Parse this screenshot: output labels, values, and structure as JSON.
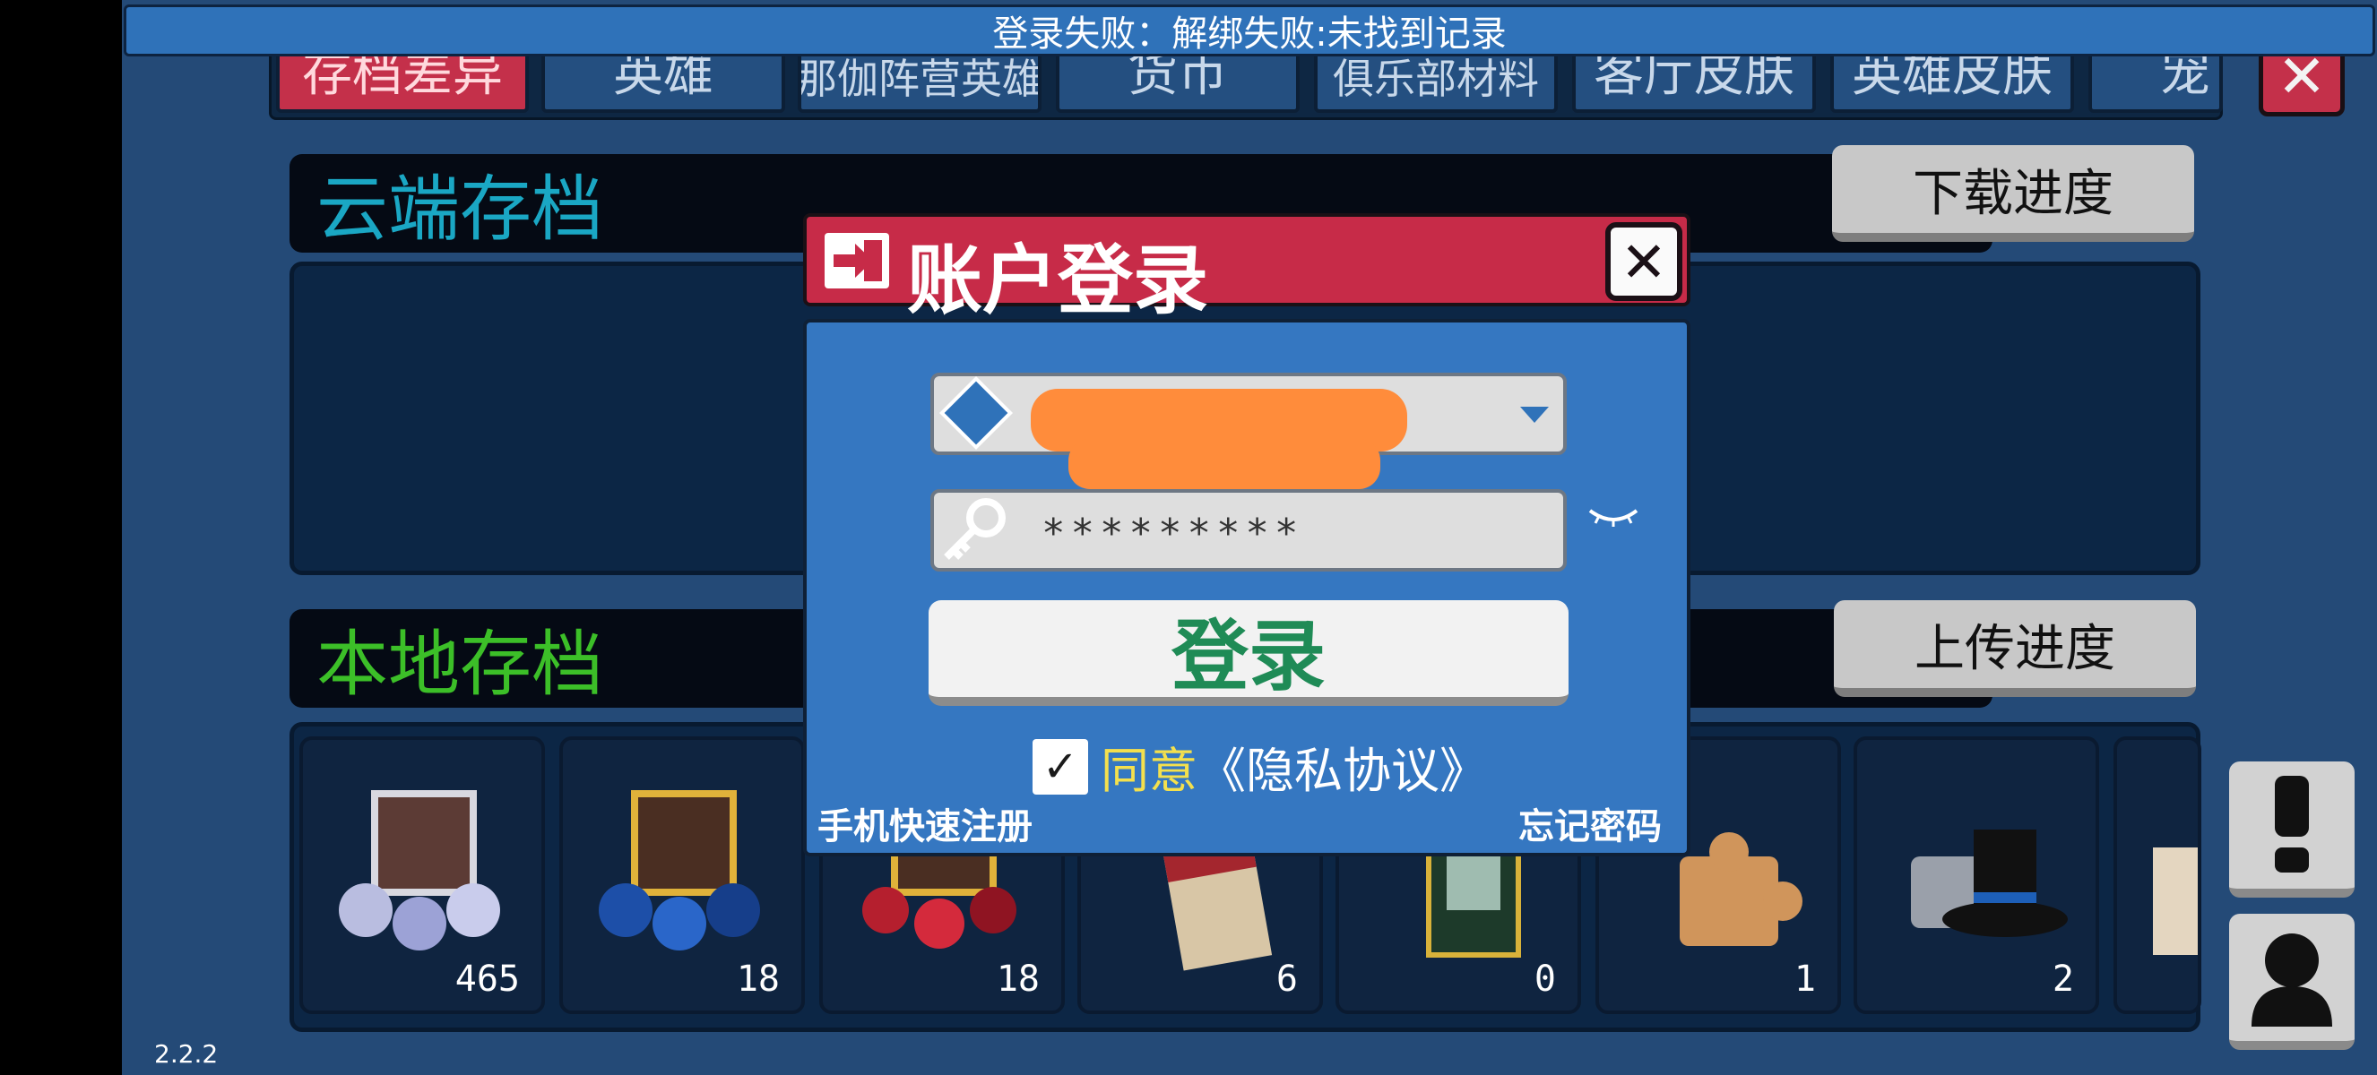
{
  "toast": {
    "message": "登录失败：解绑失败:未找到记录"
  },
  "tabs": [
    {
      "label": "存档差异",
      "active": true
    },
    {
      "label": "英雄",
      "active": false
    },
    {
      "label": "那伽阵营英雄",
      "active": false
    },
    {
      "label": "货币",
      "active": false
    },
    {
      "label": "俱乐部材料",
      "active": false
    },
    {
      "label": "客厅皮肤",
      "active": false
    },
    {
      "label": "英雄皮肤",
      "active": false
    },
    {
      "label": "宠",
      "active": false
    }
  ],
  "cloud": {
    "title": "云端存档",
    "button": "下载进度"
  },
  "local": {
    "title": "本地存档",
    "button": "上传进度",
    "items": [
      {
        "icon": "silver-gem-chest-icon",
        "count": "465"
      },
      {
        "icon": "gold-gem-chest-icon",
        "count": "18"
      },
      {
        "icon": "red-gem-chest-icon",
        "count": "18"
      },
      {
        "icon": "ticket-icon",
        "count": "6"
      },
      {
        "icon": "card-icon",
        "count": "0"
      },
      {
        "icon": "puzzle-piece-icon",
        "count": "1"
      },
      {
        "icon": "top-hat-icon",
        "count": "2"
      },
      {
        "icon": "scroll-icon",
        "count": ""
      }
    ]
  },
  "dialog": {
    "title": "账户登录",
    "password_value": "*********",
    "login_button": "登录",
    "agree_label": "同意",
    "privacy_link": "《隐私协议》",
    "register_link": "手机快速注册",
    "forgot_link": "忘记密码"
  },
  "version": "2.2.2",
  "colors": {
    "accent_red": "#c72b48",
    "dialog_blue": "#3577c1",
    "login_green": "#1f8b56",
    "cloud_cyan": "#1aa7c4",
    "local_green": "#3cbf28"
  }
}
